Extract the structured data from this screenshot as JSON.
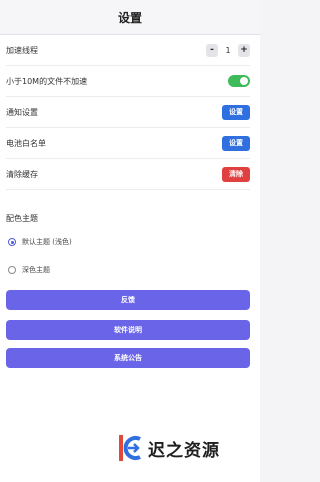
{
  "header": {
    "title": "设置"
  },
  "settings": {
    "threads_label": "加速线程",
    "threads_minus": "-",
    "threads_value": "1",
    "threads_plus": "+",
    "small_file_label": "小于10M的文件不加速",
    "small_file_enabled": true,
    "notify_label": "通知设置",
    "notify_button": "设置",
    "battery_label": "电池白名单",
    "battery_button": "设置",
    "cache_label": "清除缓存",
    "cache_button": "清除"
  },
  "theme": {
    "title": "配色主题",
    "options": [
      {
        "label": "默认主题 (浅色)",
        "selected": true
      },
      {
        "label": "深色主题",
        "selected": false
      }
    ]
  },
  "actions": {
    "feedback": "反馈",
    "about": "软件说明",
    "notice": "系统公告"
  },
  "watermark": {
    "text": "迟之资源"
  },
  "colors": {
    "accent": "#6a64e8",
    "blue_button": "#2f6fe0",
    "red_button": "#e0403f",
    "toggle_on": "#3dbb5b"
  }
}
